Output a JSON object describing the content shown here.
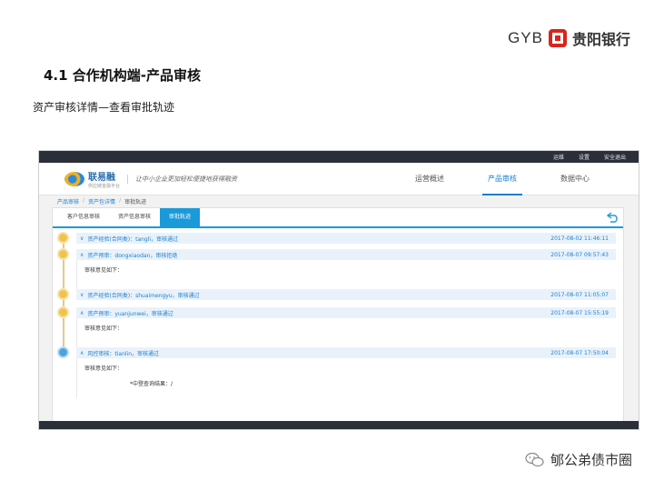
{
  "logo": {
    "latin": "GYB",
    "chinese": "贵阳银行"
  },
  "slide": {
    "title": "4.1 合作机构端-产品审核",
    "subtitle": "资产审核详情—查看审批轨迹"
  },
  "app": {
    "topbar": [
      "运维",
      "设置",
      "安全退出"
    ],
    "brand": {
      "name": "联易融",
      "sub": "供应链金融平台",
      "slogan": "让中小企业更加轻松便捷地获得融资"
    },
    "nav": [
      {
        "label": "运营概述",
        "active": false
      },
      {
        "label": "产品审核",
        "active": true
      },
      {
        "label": "数据中心",
        "active": false
      }
    ],
    "breadcrumb": [
      "产品审核",
      "资产包详情",
      "审批轨迹"
    ],
    "tabs": [
      {
        "label": "客户信息审核",
        "active": false
      },
      {
        "label": "资产信息审核",
        "active": false
      },
      {
        "label": "审批轨迹",
        "active": true
      }
    ],
    "timeline": [
      {
        "chevron": "∨",
        "text": "资产经验(合同类)：tangli，审核通过",
        "time": "2017-08-02 11:46:11",
        "dot": "yellow",
        "body": []
      },
      {
        "chevron": "∧",
        "text": "资产预审：dongxiaodan，审核拒绝",
        "time": "2017-08-07 09:57:43",
        "dot": "yellow",
        "body": [
          "审核意见如下："
        ]
      },
      {
        "chevron": "∨",
        "text": "资产经验(合同类)：shuaimengyu，审核通过",
        "time": "2017-08-07 11:05:07",
        "dot": "yellow",
        "body": []
      },
      {
        "chevron": "∧",
        "text": "资产预审：yuanjunwei，审核通过",
        "time": "2017-08-07 15:55:19",
        "dot": "yellow",
        "body": [
          "审核意见如下："
        ]
      },
      {
        "chevron": "∧",
        "text": "风控审核：tianlin，审核通过",
        "time": "2017-08-07 17:50:04",
        "dot": "blue",
        "body": [
          "审核意见如下：",
          "*中登查询结果：/"
        ]
      }
    ]
  },
  "watermark": {
    "text": "郇公弟债市圈"
  },
  "colors": {
    "accent": "#1b9ad9",
    "brand_red": "#d9251c",
    "dark_bar": "#2b2f3a",
    "dot_yellow": "#f0c24e"
  }
}
